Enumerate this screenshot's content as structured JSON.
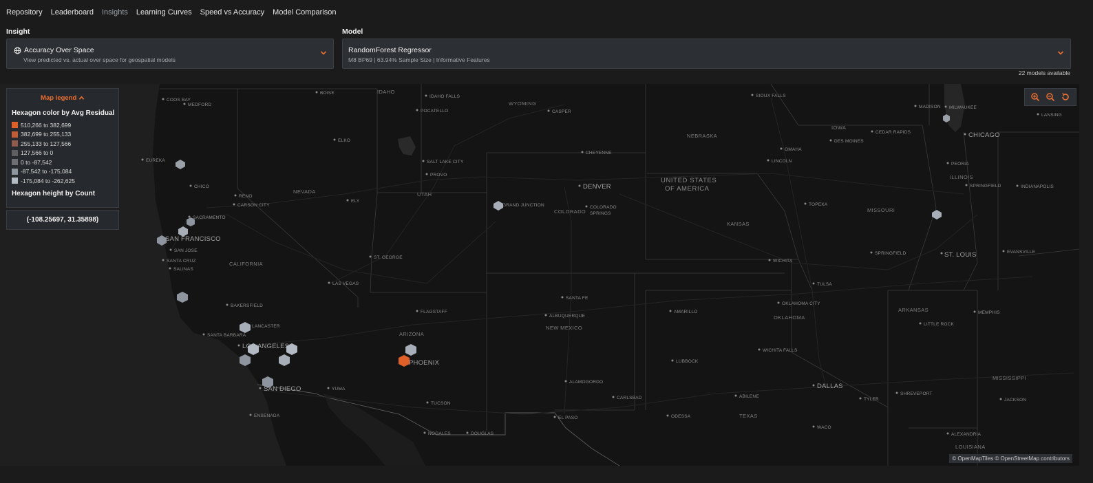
{
  "nav": {
    "items": [
      {
        "label": "Repository"
      },
      {
        "label": "Leaderboard"
      },
      {
        "label": "Insights"
      },
      {
        "label": "Learning Curves"
      },
      {
        "label": "Speed vs Accuracy"
      },
      {
        "label": "Model Comparison"
      }
    ],
    "active_index": 2
  },
  "insight": {
    "section_label": "Insight",
    "title": "Accuracy Over Space",
    "subtitle": "View predicted vs. actual over space for geospatial models",
    "icon": "globe-icon"
  },
  "model": {
    "section_label": "Model",
    "title": "RandomForest Regressor",
    "subtitle": "M8 BP69 | 63.94% Sample Size | Informative Features"
  },
  "models_available": "22 models available",
  "legend": {
    "toggle_label": "Map legend",
    "color_title": "Hexagon color by Avg Residual",
    "height_title": "Hexagon height by Count",
    "ranges": [
      {
        "label": "510,266 to 382,699",
        "color": "#e0602a"
      },
      {
        "label": "382,699 to 255,133",
        "color": "#c25c37"
      },
      {
        "label": "255,133 to 127,566",
        "color": "#8c5b4e"
      },
      {
        "label": "127,566 to 0",
        "color": "#5e5e60"
      },
      {
        "label": "0 to -87,542",
        "color": "#6c6e74"
      },
      {
        "label": "-87,542 to -175,084",
        "color": "#8f959e"
      },
      {
        "label": "-175,084 to -262,625",
        "color": "#b3bac4"
      }
    ]
  },
  "cursor_coords": "(-108.25697, 31.35898)",
  "attribution": "© OpenMapTiles © OpenStreetMap contributors",
  "colors": {
    "accent": "#e96f31",
    "background": "#1b1b1b",
    "map": "#141414"
  },
  "map": {
    "cities": [
      "COOS BAY",
      "MEDFORD",
      "EUREKA",
      "CHICO",
      "RENO",
      "CARSON CITY",
      "SACRAMENTO",
      "SAN FRANCISCO",
      "SAN JOSE",
      "SANTA CRUZ",
      "SALINAS",
      "CALIFORNIA",
      "BAKERSFIELD",
      "LANCASTER",
      "SANTA BARBARA",
      "LOS ANGELES",
      "SAN DIEGO",
      "ENSENADA",
      "YUMA",
      "LAS VEGAS",
      "ST. GEORGE",
      "NEVADA",
      "ELY",
      "ELKO",
      "BOISE",
      "IDAHO",
      "IDAHO FALLS",
      "POCATELLO",
      "SALT LAKE CITY",
      "PROVO",
      "UTAH",
      "GRAND JUNCTION",
      "COLORADO",
      "COLORADO SPRINGS",
      "DENVER",
      "CHEYENNE",
      "CASPER",
      "WYOMING",
      "FLAGSTAFF",
      "ARIZONA",
      "PHOENIX",
      "TUCSON",
      "NOGALES",
      "DOUGLAS",
      "EL PASO",
      "SANTA FE",
      "ALBUQUERQUE",
      "NEW MEXICO",
      "ALAMOGORDO",
      "CARLSBAD",
      "AMARILLO",
      "LUBBOCK",
      "ODESSA",
      "ABILENE",
      "TEXAS",
      "WICHITA FALLS",
      "OKLAHOMA CITY",
      "OKLAHOMA",
      "TULSA",
      "WICHITA",
      "KANSAS",
      "TOPEKA",
      "LINCOLN",
      "OMAHA",
      "NEBRASKA",
      "SIOUX FALLS",
      "DES MOINES",
      "CEDAR RAPIDS",
      "IOWA",
      "MISSOURI",
      "SPRINGFIELD",
      "ST. LOUIS",
      "ARKANSAS",
      "LITTLE ROCK",
      "MEMPHIS",
      "SHREVEPORT",
      "DALLAS",
      "TYLER",
      "WACO",
      "ALEXANDRIA",
      "LOUISIANA",
      "JACKSON",
      "MISSISSIPPI",
      "ILLINOIS",
      "PEORIA",
      "INDIANAPOLIS",
      "EVANSVILLE",
      "CHICAGO",
      "MADISON",
      "MILWAUKEE",
      "MICHIGAN",
      "LANSING",
      "UNITED STATES OF AMERICA"
    ]
  }
}
